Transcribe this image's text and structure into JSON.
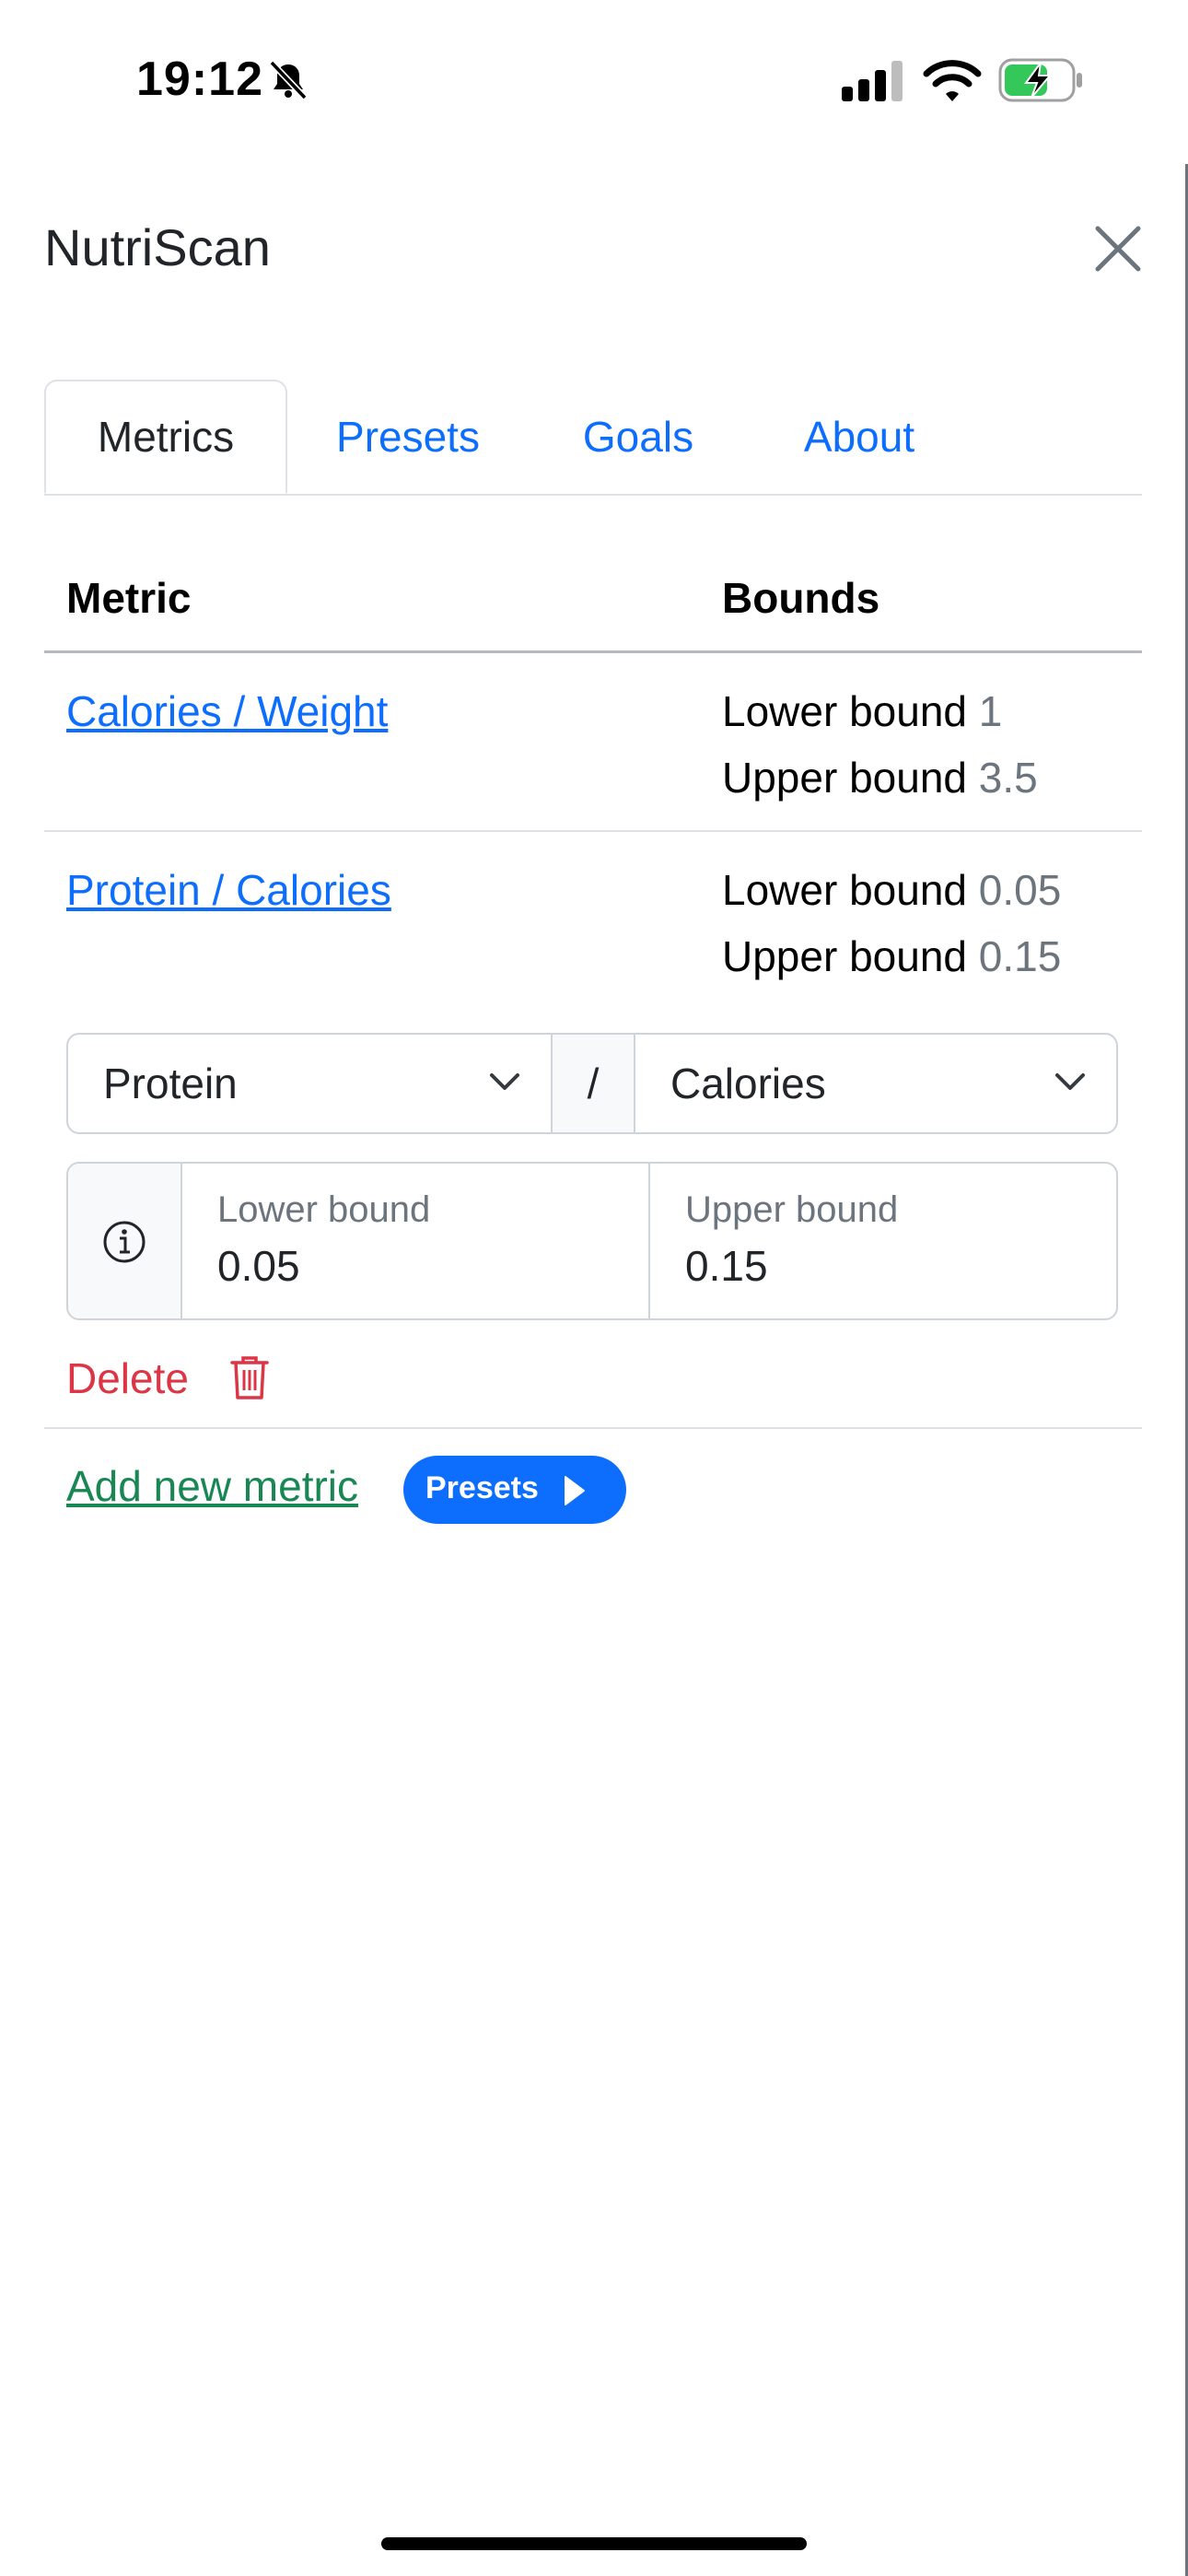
{
  "status_bar": {
    "time": "19:12",
    "icons": [
      "bell-slash-icon",
      "cellular-signal-icon",
      "wifi-icon",
      "battery-charging-icon"
    ]
  },
  "header": {
    "title": "NutriScan",
    "close_icon": "close-icon"
  },
  "tabs": [
    {
      "label": "Metrics",
      "active": true
    },
    {
      "label": "Presets",
      "active": false
    },
    {
      "label": "Goals",
      "active": false
    },
    {
      "label": "About",
      "active": false
    }
  ],
  "table": {
    "headers": {
      "metric": "Metric",
      "bounds": "Bounds"
    },
    "rows": [
      {
        "metric": "Calories / Weight",
        "lower_label": "Lower bound",
        "lower": "1",
        "upper_label": "Upper bound",
        "upper": "3.5"
      },
      {
        "metric": "Protein / Calories",
        "lower_label": "Lower bound",
        "lower": "0.05",
        "upper_label": "Upper bound",
        "upper": "0.15"
      }
    ]
  },
  "editor": {
    "numerator": "Protein",
    "separator": "/",
    "denominator": "Calories",
    "lower_label": "Lower bound",
    "lower_value": "0.05",
    "upper_label": "Upper bound",
    "upper_value": "0.15",
    "delete_label": "Delete"
  },
  "footer": {
    "add_label": "Add new metric",
    "presets_label": "Presets"
  },
  "colors": {
    "primary": "#0d6efd",
    "danger": "#dc3545",
    "success": "#198754",
    "muted": "#6c757d",
    "border": "#dee2e6"
  }
}
